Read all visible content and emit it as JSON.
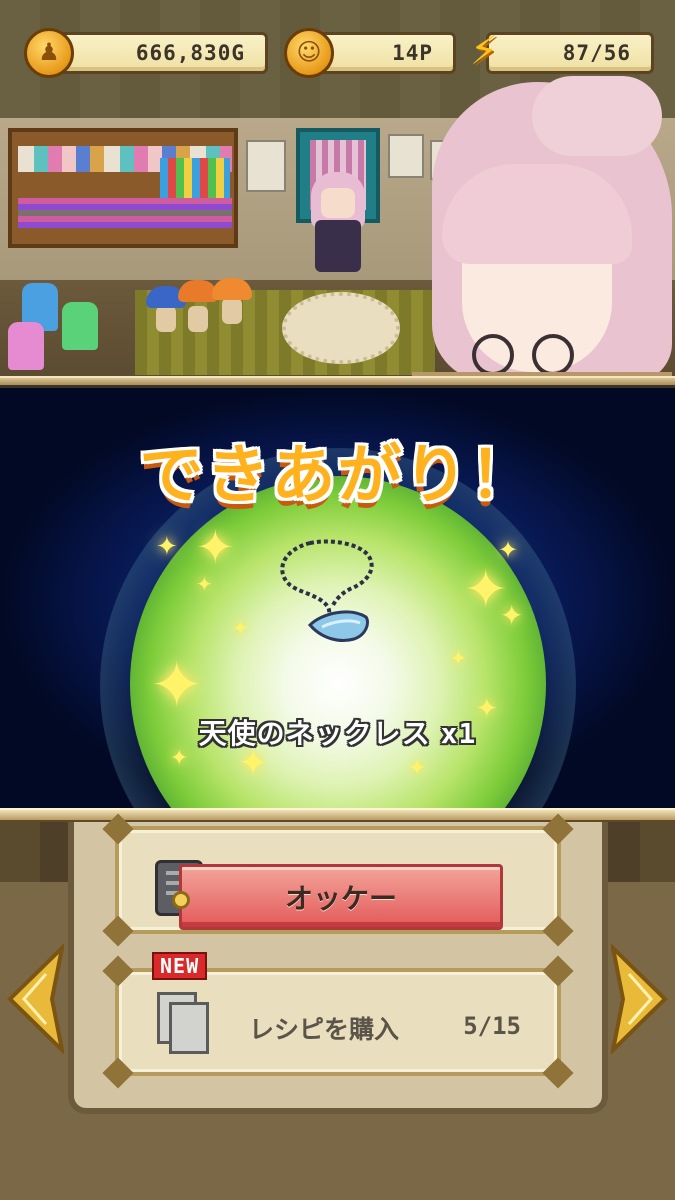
{
  "hud": {
    "gold": "666,830G",
    "points": "14P",
    "stamina": "87/56",
    "gold_icon": "gold-coin-icon",
    "points_icon": "smile-coin-icon",
    "stamina_icon": "lightning-bolt-icon"
  },
  "result": {
    "headline": "できあがり！",
    "item_name": "天使のネックレス",
    "item_qty": "x1",
    "item_icon": "angel-necklace-icon"
  },
  "menu": {
    "ok_label": "オッケー",
    "recipe_label": "レシピを購入",
    "recipe_count": "5/15",
    "new_badge": "NEW",
    "left_arrow_icon": "arrow-left-icon",
    "right_arrow_icon": "arrow-right-icon"
  },
  "colors": {
    "headline": "#ffb21e",
    "ok_button": "#e45a5a",
    "background_blue": "#0b2570",
    "glow_green": "#7dcc3a"
  }
}
